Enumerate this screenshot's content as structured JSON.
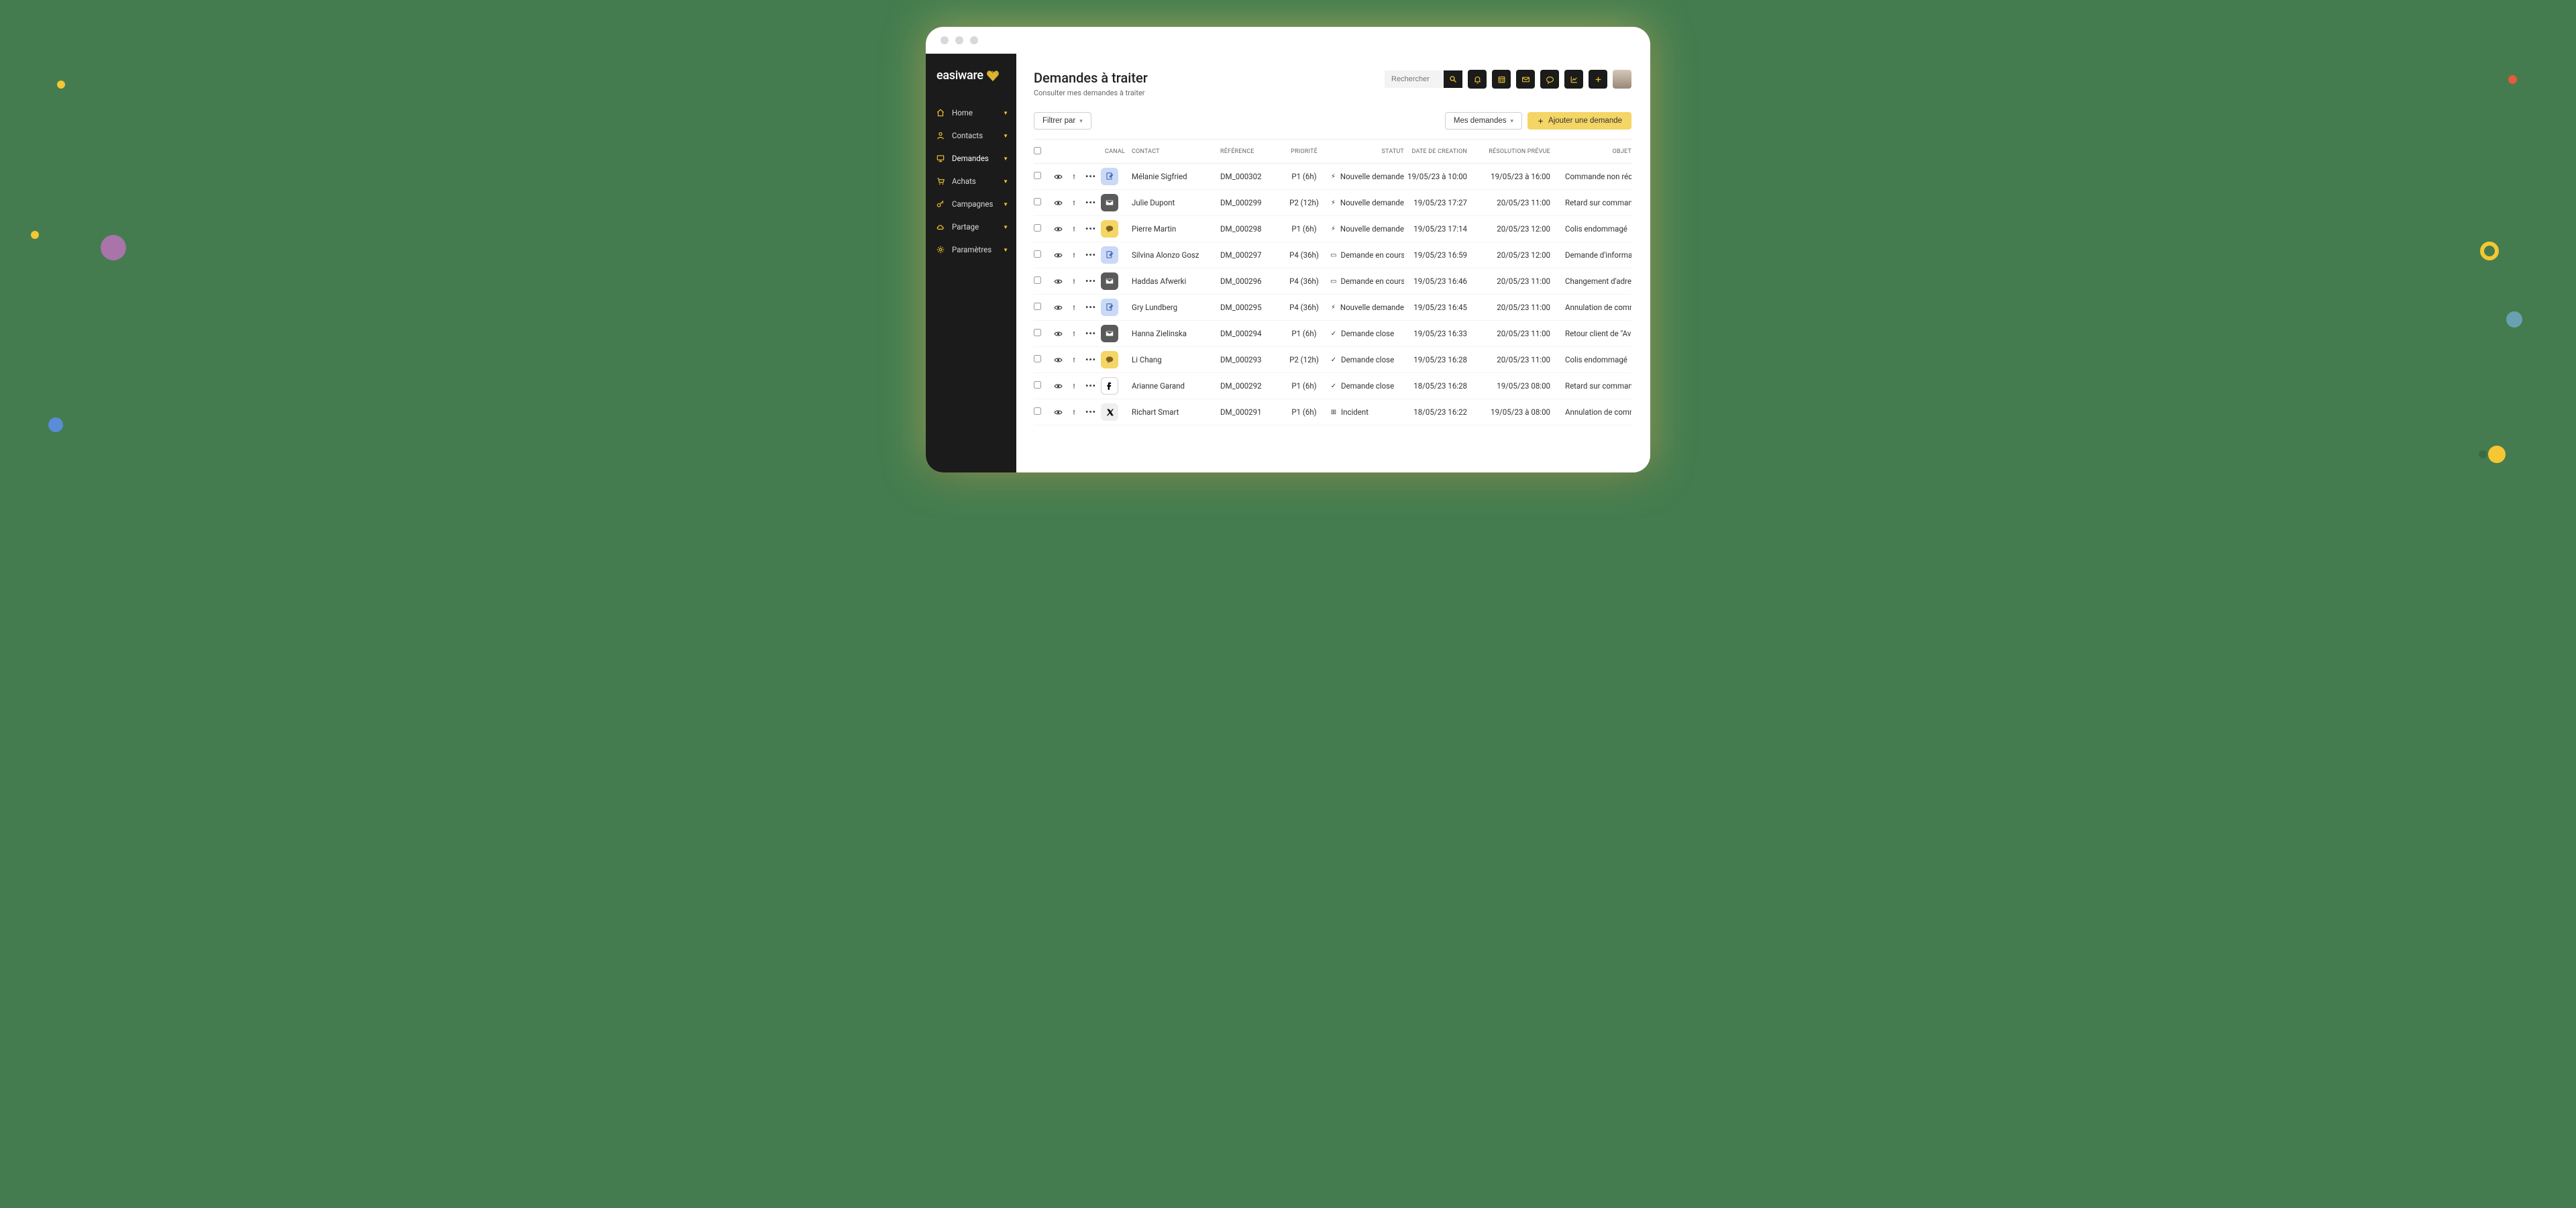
{
  "brand": "easiware",
  "page": {
    "title": "Demandes à traiter",
    "subtitle": "Consulter mes demandes à traiter"
  },
  "search": {
    "placeholder": "Rechercher"
  },
  "sidebar": {
    "items": [
      {
        "label": "Home",
        "icon": "home"
      },
      {
        "label": "Contacts",
        "icon": "person"
      },
      {
        "label": "Demandes",
        "icon": "monitor",
        "active": true
      },
      {
        "label": "Achats",
        "icon": "cart"
      },
      {
        "label": "Campagnes",
        "icon": "key"
      },
      {
        "label": "Partage",
        "icon": "cloud"
      },
      {
        "label": "Paramètres",
        "icon": "gear"
      }
    ]
  },
  "toolbar": {
    "filter_label": "Filtrer par",
    "scope_label": "Mes demandes",
    "add_label": "Ajouter une demande"
  },
  "columns": {
    "canal": "CANAL",
    "contact": "CONTACT",
    "reference": "RÉFÉRENCE",
    "priorite": "PRIORITÉ",
    "statut": "STATUT",
    "creation": "DATE DE CREATION",
    "resolution": "RÉSOLUTION PRÉVUE",
    "objet": "OBJET"
  },
  "rows": [
    {
      "canal": "form",
      "contact": "Mélanie Sigfried",
      "ref": "DM_000302",
      "prio": "P1 (6h)",
      "status": "Nouvelle demande",
      "st": "bolt",
      "created": "19/05/23 à 10:00",
      "due": "19/05/23 à 16:00",
      "objet": "Commande non récepti"
    },
    {
      "canal": "email",
      "contact": "Julie Dupont",
      "ref": "DM_000299",
      "prio": "P2 (12h)",
      "status": "Nouvelle demande",
      "st": "bolt",
      "created": "19/05/23 17:27",
      "due": "20/05/23 11:00",
      "objet": "Retard sur commande"
    },
    {
      "canal": "chat",
      "contact": "Pierre Martin",
      "ref": "DM_000298",
      "prio": "P1 (6h)",
      "status": "Nouvelle demande",
      "st": "bolt",
      "created": "19/05/23 17:14",
      "due": "20/05/23 12:00",
      "objet": "Colis endommagé"
    },
    {
      "canal": "form",
      "contact": "Silvina Alonzo Gosz",
      "ref": "DM_000297",
      "prio": "P4 (36h)",
      "status": "Demande en cours",
      "st": "prog",
      "created": "19/05/23 16:59",
      "due": "20/05/23 12:00",
      "objet": "Demande d'informations"
    },
    {
      "canal": "email",
      "contact": "Haddas Afwerki",
      "ref": "DM_000296",
      "prio": "P4 (36h)",
      "status": "Demande en cours",
      "st": "prog",
      "created": "19/05/23 16:46",
      "due": "20/05/23 11:00",
      "objet": "Changement d'adresse"
    },
    {
      "canal": "form",
      "contact": "Gry Lundberg",
      "ref": "DM_000295",
      "prio": "P4 (36h)",
      "status": "Nouvelle demande",
      "st": "bolt",
      "created": "19/05/23 16:45",
      "due": "20/05/23 11:00",
      "objet": "Annulation de comman"
    },
    {
      "canal": "email",
      "contact": "Hanna Zielinska",
      "ref": "DM_000294",
      "prio": "P1 (6h)",
      "status": "Demande close",
      "st": "done",
      "created": "19/05/23 16:33",
      "due": "20/05/23 11:00",
      "objet": "Retour client de \"Avis Vé"
    },
    {
      "canal": "chat",
      "contact": "Li Chang",
      "ref": "DM_000293",
      "prio": "P2 (12h)",
      "status": "Demande close",
      "st": "done",
      "created": "19/05/23 16:28",
      "due": "20/05/23 11:00",
      "objet": "Colis endommagé"
    },
    {
      "canal": "fb",
      "contact": "Arianne Garand",
      "ref": "DM_000292",
      "prio": "P1 (6h)",
      "status": "Demande close",
      "st": "done",
      "created": "18/05/23 16:28",
      "due": "19/05/23 08:00",
      "objet": "Retard sur commande"
    },
    {
      "canal": "x",
      "contact": "Richart Smart",
      "ref": "DM_000291",
      "prio": "P1 (6h)",
      "status": "Incident",
      "st": "inc",
      "created": "18/05/23 16:22",
      "due": "19/05/23 à 08:00",
      "objet": "Annulation de comman"
    }
  ]
}
